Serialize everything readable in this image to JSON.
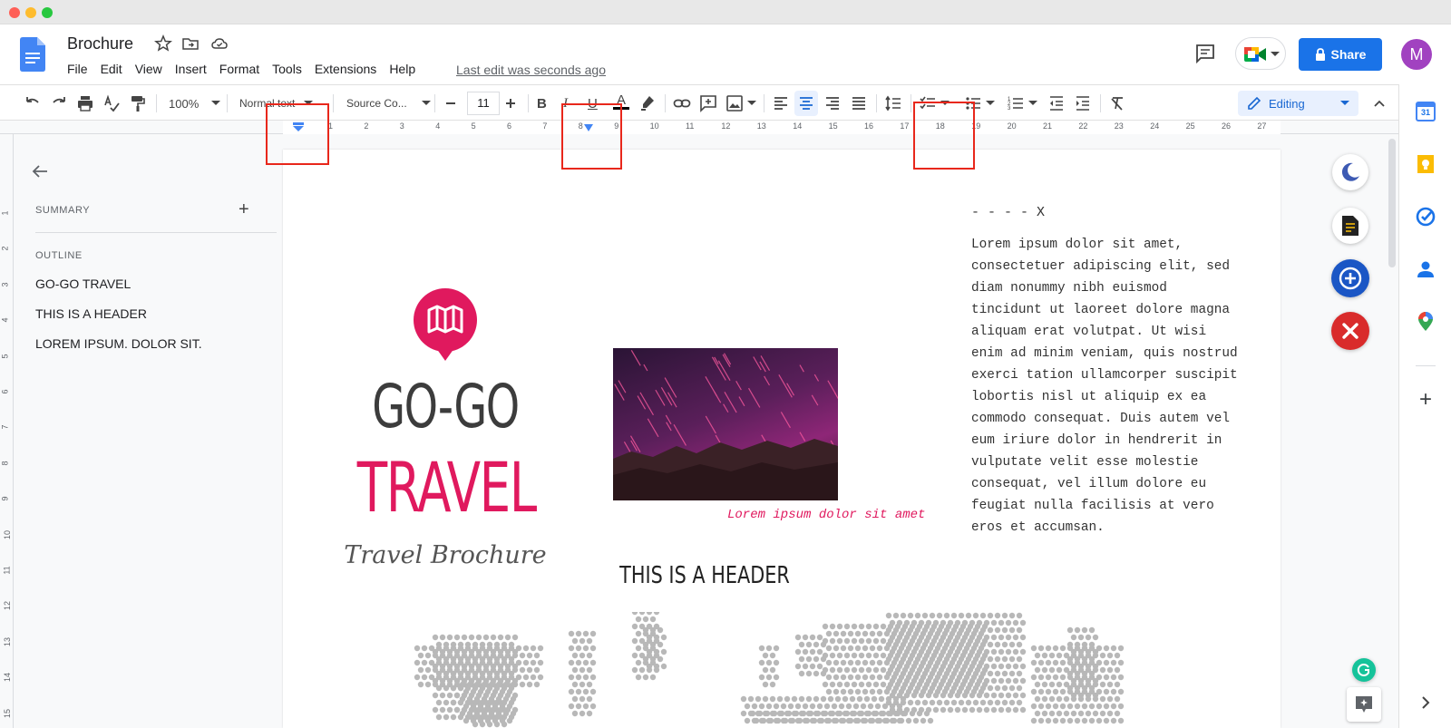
{
  "doc": {
    "title": "Brochure",
    "menu": [
      "File",
      "Edit",
      "View",
      "Insert",
      "Format",
      "Tools",
      "Extensions",
      "Help"
    ],
    "last_edit": "Last edit was seconds ago",
    "share_label": "Share",
    "avatar_letter": "M"
  },
  "toolbar": {
    "zoom": "100%",
    "style": "Normal text",
    "font": "Source Co...",
    "font_size": "11",
    "bold": "B",
    "italic": "I",
    "underline": "U",
    "text_color": "A",
    "mode": "Editing"
  },
  "ruler": {
    "h_numbers": [
      "1",
      "2",
      "3",
      "4",
      "5",
      "6",
      "7",
      "8",
      "9",
      "10",
      "11",
      "12",
      "13",
      "14",
      "15",
      "16",
      "17",
      "18",
      "19",
      "20",
      "21",
      "22",
      "23",
      "24",
      "25",
      "26",
      "27"
    ],
    "v_numbers": [
      "1",
      "2",
      "3",
      "4",
      "5",
      "6",
      "7",
      "8",
      "9",
      "10",
      "11",
      "12",
      "13",
      "14",
      "15"
    ]
  },
  "sidebar": {
    "summary_label": "SUMMARY",
    "add": "+",
    "outline_label": "OUTLINE",
    "outline": [
      "GO-GO TRAVEL",
      "THIS IS A HEADER",
      "LOREM IPSUM. DOLOR SIT."
    ]
  },
  "page": {
    "title_line1": "GO-GO",
    "title_line2": "TRAVEL",
    "subtitle": "Travel Brochure",
    "caption": "Lorem ipsum dolor sit amet",
    "cross_line": "- - - - X",
    "body_lines": [
      "Lorem ipsum dolor sit amet,",
      "consectetuer adipiscing elit, sed",
      "diam nonummy nibh euismod",
      "tincidunt ut laoreet dolore magna",
      "aliquam erat volutpat. Ut wisi",
      "enim ad minim veniam, quis nostrud",
      "exerci tation ullamcorper suscipit",
      "lobortis nisl ut aliquip ex ea",
      "commodo consequat. Duis autem vel",
      "eum iriure dolor in hendrerit in",
      "vulputate velit esse molestie",
      "consequat, vel illum dolore eu",
      "feugiat nulla facilisis at vero",
      "eros et accumsan."
    ],
    "header": "THIS IS A HEADER"
  },
  "colors": {
    "accent_pink": "#e0195e",
    "share_blue": "#1a73e8",
    "annotation_red": "#e8271b",
    "avatar_purple": "#a142c0"
  },
  "side_panel": {
    "icons": [
      "calendar-icon",
      "keep-icon",
      "tasks-icon",
      "contacts-icon",
      "maps-icon",
      "add-icon",
      "expand-icon"
    ]
  },
  "side_panel_text": {
    "calendar_day": "31",
    "plus": "+"
  }
}
